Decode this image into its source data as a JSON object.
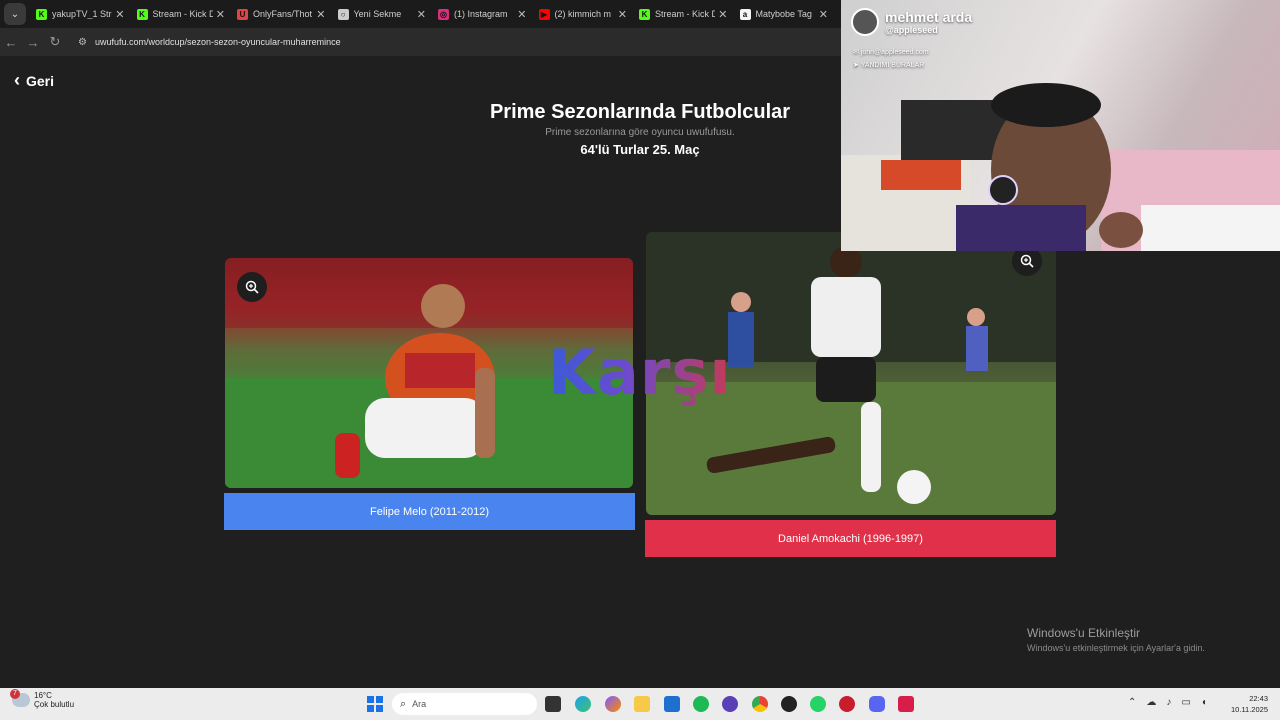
{
  "browser": {
    "tabs": [
      {
        "label": "yakupTV_1 Stre",
        "fav_color": "#53fc18",
        "fav_glyph": "K"
      },
      {
        "label": "Stream - Kick D",
        "fav_color": "#53fc18",
        "fav_glyph": "K"
      },
      {
        "label": "OnlyFans/Thot",
        "fav_color": "#e04545",
        "fav_glyph": "U"
      },
      {
        "label": "Yeni Sekme",
        "fav_color": "#cccccc",
        "fav_glyph": "○"
      },
      {
        "label": "(1) Instagram",
        "fav_color": "#d6307a",
        "fav_glyph": "◎"
      },
      {
        "label": "(2) kimmich m",
        "fav_color": "#ff0000",
        "fav_glyph": "▶"
      },
      {
        "label": "Stream - Kick D",
        "fav_color": "#53fc18",
        "fav_glyph": "K"
      },
      {
        "label": "Matybobe Tag",
        "fav_color": "#f5f5f5",
        "fav_glyph": "a"
      }
    ],
    "url": "uwufufu.com/worldcup/sezon-sezon-oyuncular-muharremince",
    "close_glyph": "✕"
  },
  "page": {
    "back_label": "Geri",
    "title": "Prime Sezonlarında Futbolcular",
    "subtitle": "Prime sezonlarına göre oyuncu uwufufusu.",
    "round": "64'lü Turlar 25. Maç",
    "versus": "Karşı",
    "left_choice": {
      "label": "Felipe Melo (2011-2012)",
      "color": "#4a84ee"
    },
    "right_choice": {
      "label": "Daniel Amokachi (1996-1997)",
      "color": "#e13049"
    }
  },
  "webcam": {
    "name": "mehmet arda",
    "handle": "@appleseed",
    "email": "john@appleseed.com",
    "location": "YANDIMI BURALAR"
  },
  "windows_activation": {
    "line1": "Windows'u Etkinleştir",
    "line2": "Windows'u etkinleştirmek için Ayarlar'a gidin."
  },
  "taskbar": {
    "weather_badge": "7",
    "temperature": "16°C",
    "condition": "Çok bulutlu",
    "search_placeholder": "Ara",
    "time": "22:43",
    "date": "10.11.2025"
  }
}
